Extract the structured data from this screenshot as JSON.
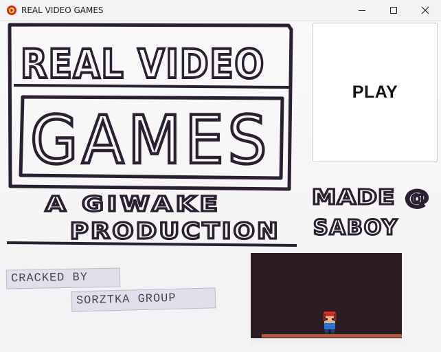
{
  "window": {
    "title": "REAL VIDEO GAMES",
    "icon": "game-app-icon",
    "controls": [
      "minimize-icon",
      "maximize-icon",
      "close-icon"
    ]
  },
  "title_art": {
    "line1": "REAL VIDEO",
    "line2": "GAMES",
    "line3": "A GIWAKE",
    "line4": "PRODUCTION"
  },
  "credit_art": {
    "line1": "MADE @",
    "line2": "SABOY"
  },
  "play_button": {
    "label": "PLAY"
  },
  "labels": {
    "cracked_by": "CRACKED BY",
    "group": "SORZTKA GROUP"
  },
  "colors": {
    "ink": "#2b2030",
    "paper": "#f8f8f8",
    "tape": "#e3dfea",
    "photo_bg": "#2a1c22",
    "floor": "#b55a3d"
  }
}
